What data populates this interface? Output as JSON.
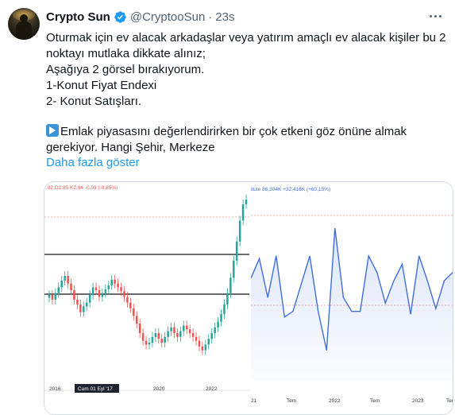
{
  "author": {
    "name": "Crypto Sun",
    "handle": "@CryptooSun",
    "separator": "·",
    "time": "23s",
    "verified": true
  },
  "tweet": {
    "lines": [
      "Oturmak için ev alacak arkadaşlar veya yatırım amaçlı ev alacak kişiler bu 2",
      "noktayı mutlaka dikkate alınız;",
      "Aşağıya 2 görsel bırakıyorum.",
      "1-Konut Fiyat Endexi",
      "2- Konut Satışları.",
      "",
      "Emlak piyasasını değerlendirirken bir çok etkeni göz önüne almak",
      "gerekiyor. Hangi Şehir, Merkeze"
    ],
    "emoji_icon": "right-arrow-emoji-icon",
    "show_more": "Daha fazla göster"
  },
  "colors": {
    "link": "#1d9bf0",
    "secondary_text": "#536471",
    "candle_up": "#26a69a",
    "candle_down": "#ef5350",
    "line_series": "#3f6fd8",
    "verified_badge": "#1d9bf0"
  },
  "chart_data": [
    {
      "type": "candlestick",
      "header": ",02 D2,85 K2,94 -0,03 (-0,85%)",
      "x_tick_labels": [
        "2016",
        "2020",
        "2022"
      ],
      "cursor_label": "Cum 01 Eyl '17",
      "horizontal_lines": 2,
      "series": [
        {
          "name": "",
          "close": [
            2.1,
            2.05,
            2.12,
            2.18,
            2.25,
            2.3,
            2.22,
            2.15,
            2.05,
            2.0,
            1.92,
            1.98,
            2.02,
            2.1,
            2.18,
            2.15,
            2.08,
            2.12,
            2.16,
            2.2,
            2.26,
            2.22,
            2.18,
            2.14,
            2.08,
            2.02,
            1.96,
            1.88,
            1.8,
            1.7,
            1.62,
            1.58,
            1.6,
            1.66,
            1.7,
            1.64,
            1.6,
            1.66,
            1.72,
            1.76,
            1.7,
            1.66,
            1.72,
            1.78,
            1.74,
            1.7,
            1.66,
            1.62,
            1.56,
            1.52,
            1.58,
            1.64,
            1.7,
            1.76,
            1.82,
            1.9,
            2.0,
            2.12,
            2.28,
            2.46,
            2.66,
            2.88,
            3.05,
            3.1
          ]
        }
      ]
    },
    {
      "type": "line",
      "header": "itute  86,304K  +32,416K (+60,15%)",
      "x_tick_labels": [
        "21",
        "Tem",
        "2022",
        "Tem",
        "2023",
        "Tem"
      ],
      "series": [
        {
          "name": "",
          "values": [
            92,
            99,
            85,
            100,
            78,
            80,
            90,
            100,
            80,
            66,
            110,
            85,
            80,
            80,
            100,
            94,
            83,
            91,
            97,
            79,
            100,
            91,
            81,
            91,
            94
          ]
        }
      ]
    }
  ]
}
